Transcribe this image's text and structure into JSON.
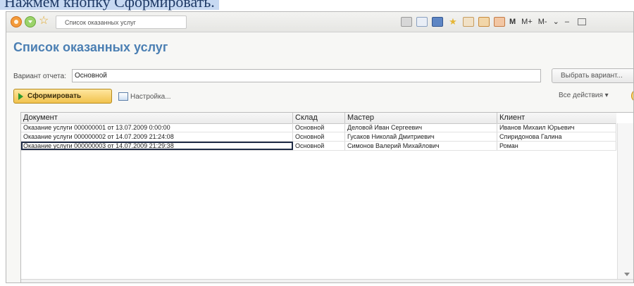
{
  "caption": "Нажмем кнопку Сформировать.",
  "window": {
    "tab_title": "Список оказанных услуг",
    "toolbar": {
      "m": "M",
      "m_plus": "M+",
      "m_minus": "M-"
    }
  },
  "form": {
    "title": "Список оказанных услуг",
    "variant_label": "Вариант отчета:",
    "variant_value": "Основной",
    "choose_variant_button": "Выбрать вариант...",
    "generate_button": "Сформировать",
    "settings_button": "Настройка...",
    "all_actions": "Все действия ▾"
  },
  "table": {
    "columns": [
      "Документ",
      "Склад",
      "Мастер",
      "Клиент"
    ],
    "rows": [
      [
        "Оказание услуги 000000001 от 13.07.2009 0:00:00",
        "Основной",
        "Деловой Иван Сергеевич",
        "Иванов Михаил Юрьевич"
      ],
      [
        "Оказание услуги 000000002 от 14.07.2009 21:24:08",
        "Основной",
        "Гусаков Николай Дмитриевич",
        "Спиридонова Галина"
      ],
      [
        "Оказание услуги 000000003 от 14.07.2009 21:29:38",
        "Основной",
        "Симонов Валерий Михайлович",
        "Роман"
      ]
    ],
    "selected_row": 2
  },
  "colors": {
    "title": "#4b7fb3",
    "generate_button": "#f1c24d",
    "selection_border": "#1f2b45"
  },
  "icons": {
    "logo": "1c-logo-icon",
    "menu": "main-menu-icon",
    "favorite": "star-icon",
    "generate": "play-icon",
    "settings": "settings-icon",
    "help": "help-icon"
  }
}
